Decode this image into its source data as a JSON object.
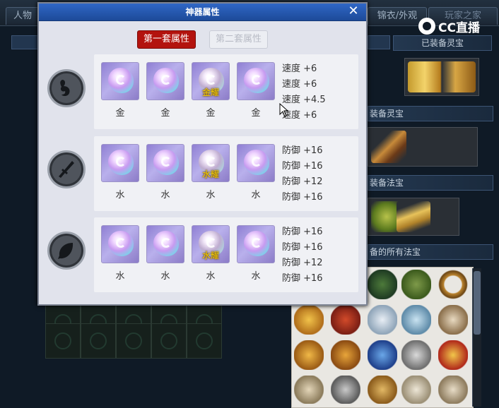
{
  "background": {
    "tabs": [
      "人物",
      "锦衣/外观",
      "玩家之家"
    ],
    "side_header": "已装备灵宝",
    "panels": [
      "装备灵宝",
      "装备法宝",
      "备的所有法宝"
    ]
  },
  "watermark": {
    "text": "CC直播"
  },
  "dialog": {
    "title": "神器属性",
    "close_icon": "close-icon",
    "set_buttons": {
      "active": "第一套属性",
      "inactive": "第二套属性"
    },
    "rows": [
      {
        "icon": "feather-icon",
        "gems": [
          {
            "element": "金",
            "tag": ""
          },
          {
            "element": "金",
            "tag": ""
          },
          {
            "element": "金",
            "tag": "金耀"
          },
          {
            "element": "金",
            "tag": ""
          }
        ],
        "stats": [
          "速度 +6",
          "速度 +6",
          "速度 +4.5",
          "速度 +6"
        ]
      },
      {
        "icon": "dagger-icon",
        "gems": [
          {
            "element": "水",
            "tag": ""
          },
          {
            "element": "水",
            "tag": ""
          },
          {
            "element": "水",
            "tag": "水耀"
          },
          {
            "element": "水",
            "tag": ""
          }
        ],
        "stats": [
          "防御 +16",
          "防御 +16",
          "防御 +12",
          "防御 +16"
        ]
      },
      {
        "icon": "leaf-icon",
        "gems": [
          {
            "element": "水",
            "tag": ""
          },
          {
            "element": "水",
            "tag": ""
          },
          {
            "element": "水",
            "tag": "水耀"
          },
          {
            "element": "水",
            "tag": ""
          }
        ],
        "stats": [
          "防御 +16",
          "防御 +16",
          "防御 +12",
          "防御 +16"
        ]
      }
    ]
  }
}
